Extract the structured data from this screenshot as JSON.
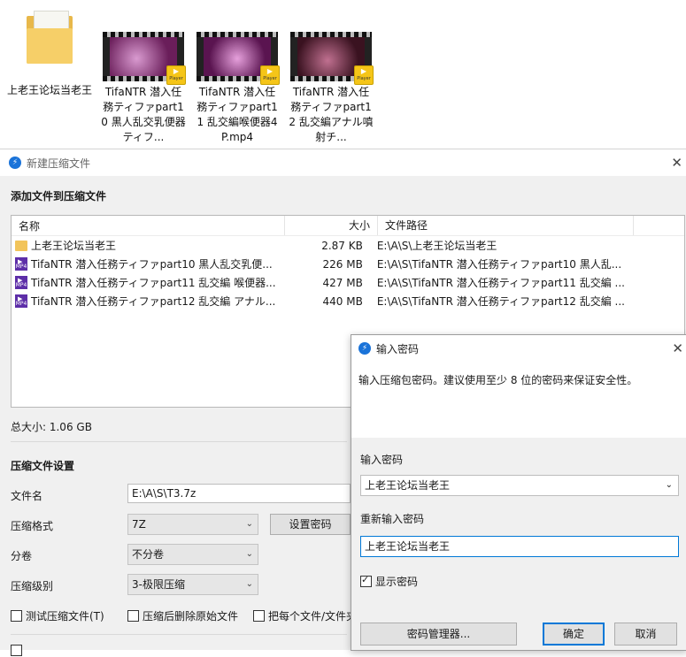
{
  "desktop": {
    "items": [
      {
        "label": "上老王论坛当老王",
        "type": "folder"
      },
      {
        "label": "TifaNTR 潜入任務ティファpart10 黒人乱交乳便器ティフ...",
        "type": "video",
        "colors": [
          "#6a1e5a",
          "#c77bb8"
        ]
      },
      {
        "label": "TifaNTR 潜入任務ティファpart11 乱交編喉便器4P.mp4",
        "type": "video",
        "colors": [
          "#5a1450",
          "#d27cc4"
        ]
      },
      {
        "label": "TifaNTR 潜入任務ティファpart12 乱交編アナル噴射チ...",
        "type": "video",
        "colors": [
          "#3a1220",
          "#b06080"
        ]
      }
    ],
    "player_badge": "Player"
  },
  "archive_dialog": {
    "title": "新建压缩文件",
    "add_section": "添加文件到压缩文件",
    "columns": {
      "name": "名称",
      "size": "大小",
      "path": "文件路径"
    },
    "files": [
      {
        "icon": "folder",
        "name": "上老王论坛当老王",
        "size": "2.87 KB",
        "path": "E:\\A\\S\\上老王论坛当老王"
      },
      {
        "icon": "mp4",
        "name": "TifaNTR 潜入任務ティファpart10 黒人乱交乳便...",
        "size": "226 MB",
        "path": "E:\\A\\S\\TifaNTR 潜入任務ティファpart10 黒人乱..."
      },
      {
        "icon": "mp4",
        "name": "TifaNTR 潜入任務ティファpart11 乱交編 喉便器...",
        "size": "427 MB",
        "path": "E:\\A\\S\\TifaNTR 潜入任務ティファpart11 乱交編 ..."
      },
      {
        "icon": "mp4",
        "name": "TifaNTR 潜入任務ティファpart12 乱交編 アナル...",
        "size": "440 MB",
        "path": "E:\\A\\S\\TifaNTR 潜入任務ティファpart12 乱交編 ..."
      }
    ],
    "total_size": "总大小: 1.06 GB",
    "settings_title": "压缩文件设置",
    "filename_label": "文件名",
    "filename_value": "E:\\A\\S\\T3.7z",
    "format_label": "压缩格式",
    "format_value": "7Z",
    "set_password_btn": "设置密码",
    "volume_label": "分卷",
    "volume_value": "不分卷",
    "level_label": "压缩级别",
    "level_value": "3-极限压缩",
    "options": [
      {
        "label": "测试压缩文件(T)",
        "checked": false
      },
      {
        "label": "压缩后删除原始文件",
        "checked": false
      },
      {
        "label": "把每个文件/文件夹",
        "checked": false
      }
    ]
  },
  "password_dialog": {
    "title": "输入密码",
    "description": "输入压缩包密码。建议使用至少 8 位的密码来保证安全性。",
    "password_label": "输入密码",
    "password_value": "上老王论坛当老王",
    "confirm_label": "重新输入密码",
    "confirm_value": "上老王论坛当老王",
    "show_password": "显示密码",
    "show_password_checked": true,
    "manager_btn": "密码管理器...",
    "ok_btn": "确定",
    "cancel_btn": "取消"
  }
}
